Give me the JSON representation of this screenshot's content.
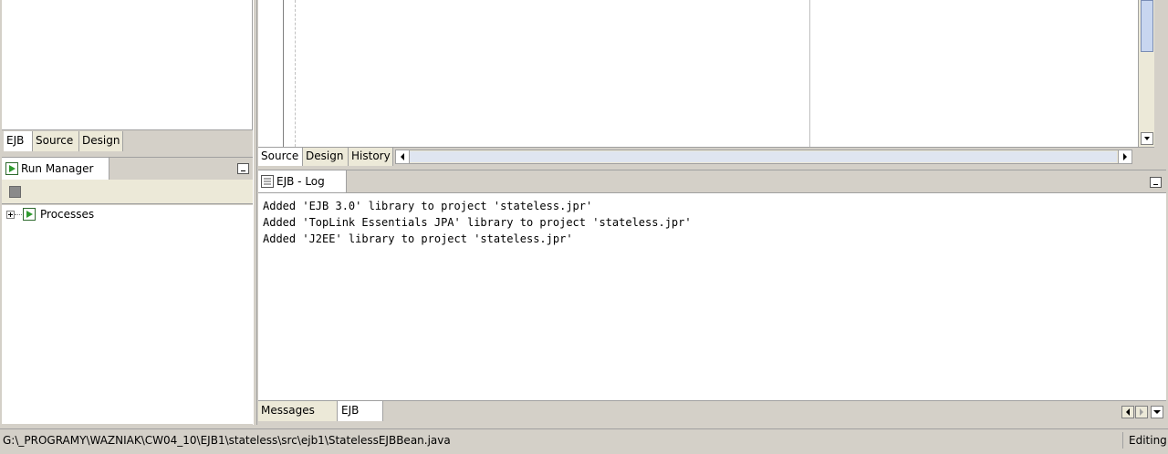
{
  "left_top": {
    "tabs": [
      "EJB",
      "Source",
      "Design"
    ]
  },
  "run_manager": {
    "title": "Run Manager",
    "tree": [
      {
        "label": "Processes"
      }
    ]
  },
  "editor": {
    "tabs": [
      "Source",
      "Design",
      "History"
    ]
  },
  "log": {
    "title": "EJB - Log",
    "lines": [
      "Added 'EJB 3.0' library to project 'stateless.jpr'",
      "Added 'TopLink Essentials JPA' library to project 'stateless.jpr'",
      "Added 'J2EE' library to project 'stateless.jpr'"
    ],
    "bottom_tabs": [
      "Messages",
      "EJB"
    ]
  },
  "status": {
    "path": "G:\\_PROGRAMY\\WAZNIAK\\CW04_10\\EJB1\\stateless\\src\\ejb1\\StatelessEJBBean.java",
    "mode": "Editing"
  },
  "colors": {
    "chrome": "#d4d0c8",
    "tab_inactive": "#ece9d8",
    "run_icon_green": "#2e9a2e"
  }
}
